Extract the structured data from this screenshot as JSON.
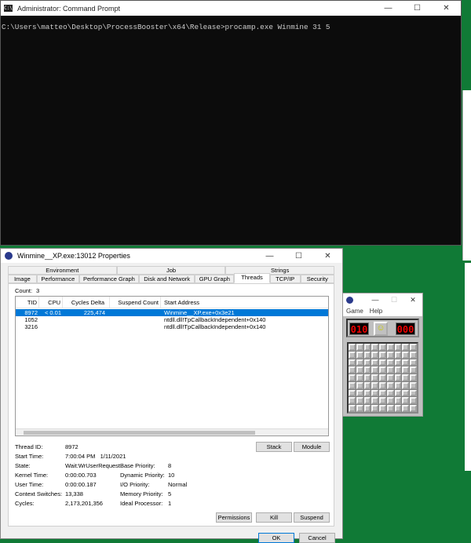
{
  "cmd": {
    "title": "Administrator: Command Prompt",
    "prompt": "C:\\Users\\matteo\\Desktop\\ProcessBooster\\x64\\Release>procamp.exe Winmine 31 5"
  },
  "props": {
    "title": "Winmine__XP.exe:13012 Properties",
    "tabs_row1": [
      "Environment",
      "Job",
      "Strings"
    ],
    "tabs_row2": [
      "Image",
      "Performance",
      "Performance Graph",
      "Disk and Network",
      "GPU Graph",
      "Threads",
      "TCP/IP",
      "Security"
    ],
    "active_tab": "Threads",
    "count_label": "Count:",
    "count": "3",
    "columns": [
      "TID",
      "CPU",
      "Cycles Delta",
      "Suspend Count",
      "Start Address"
    ],
    "rows": [
      {
        "tid": "8972",
        "cpu": "< 0.01",
        "cycles": "225,474",
        "suspend": "",
        "start": "Winmine__XP.exe+0x3e21",
        "selected": true
      },
      {
        "tid": "1052",
        "cpu": "",
        "cycles": "",
        "suspend": "",
        "start": "ntdll.dll!TpCallbackIndependent+0x140"
      },
      {
        "tid": "3216",
        "cpu": "",
        "cycles": "",
        "suspend": "",
        "start": "ntdll.dll!TpCallbackIndependent+0x140"
      }
    ],
    "details": {
      "thread_id_label": "Thread ID:",
      "thread_id": "8972",
      "start_time_label": "Start Time:",
      "start_time": "7:00:04 PM   1/11/2021",
      "state_label": "State:",
      "state": "Wait:WrUserRequest",
      "kernel_time_label": "Kernel Time:",
      "kernel_time": "0:00:00.703",
      "user_time_label": "User Time:",
      "user_time": "0:00:00.187",
      "context_switches_label": "Context Switches:",
      "context_switches": "13,338",
      "cycles_label": "Cycles:",
      "cycles": "2,173,201,356",
      "base_priority_label": "Base Priority:",
      "base_priority": "8",
      "dynamic_priority_label": "Dynamic Priority:",
      "dynamic_priority": "10",
      "io_priority_label": "I/O Priority:",
      "io_priority": "Normal",
      "memory_priority_label": "Memory Priority:",
      "memory_priority": "5",
      "ideal_processor_label": "Ideal Processor:",
      "ideal_processor": "1"
    },
    "buttons": {
      "stack": "Stack",
      "module": "Module",
      "permissions": "Permissions",
      "kill": "Kill",
      "suspend": "Suspend",
      "ok": "OK",
      "cancel": "Cancel"
    }
  },
  "minesweeper": {
    "menu": [
      "Game",
      "Help"
    ],
    "mines_left": "010",
    "timer": "000"
  },
  "window_controls": {
    "minimize": "—",
    "maximize": "☐",
    "close": "✕"
  }
}
